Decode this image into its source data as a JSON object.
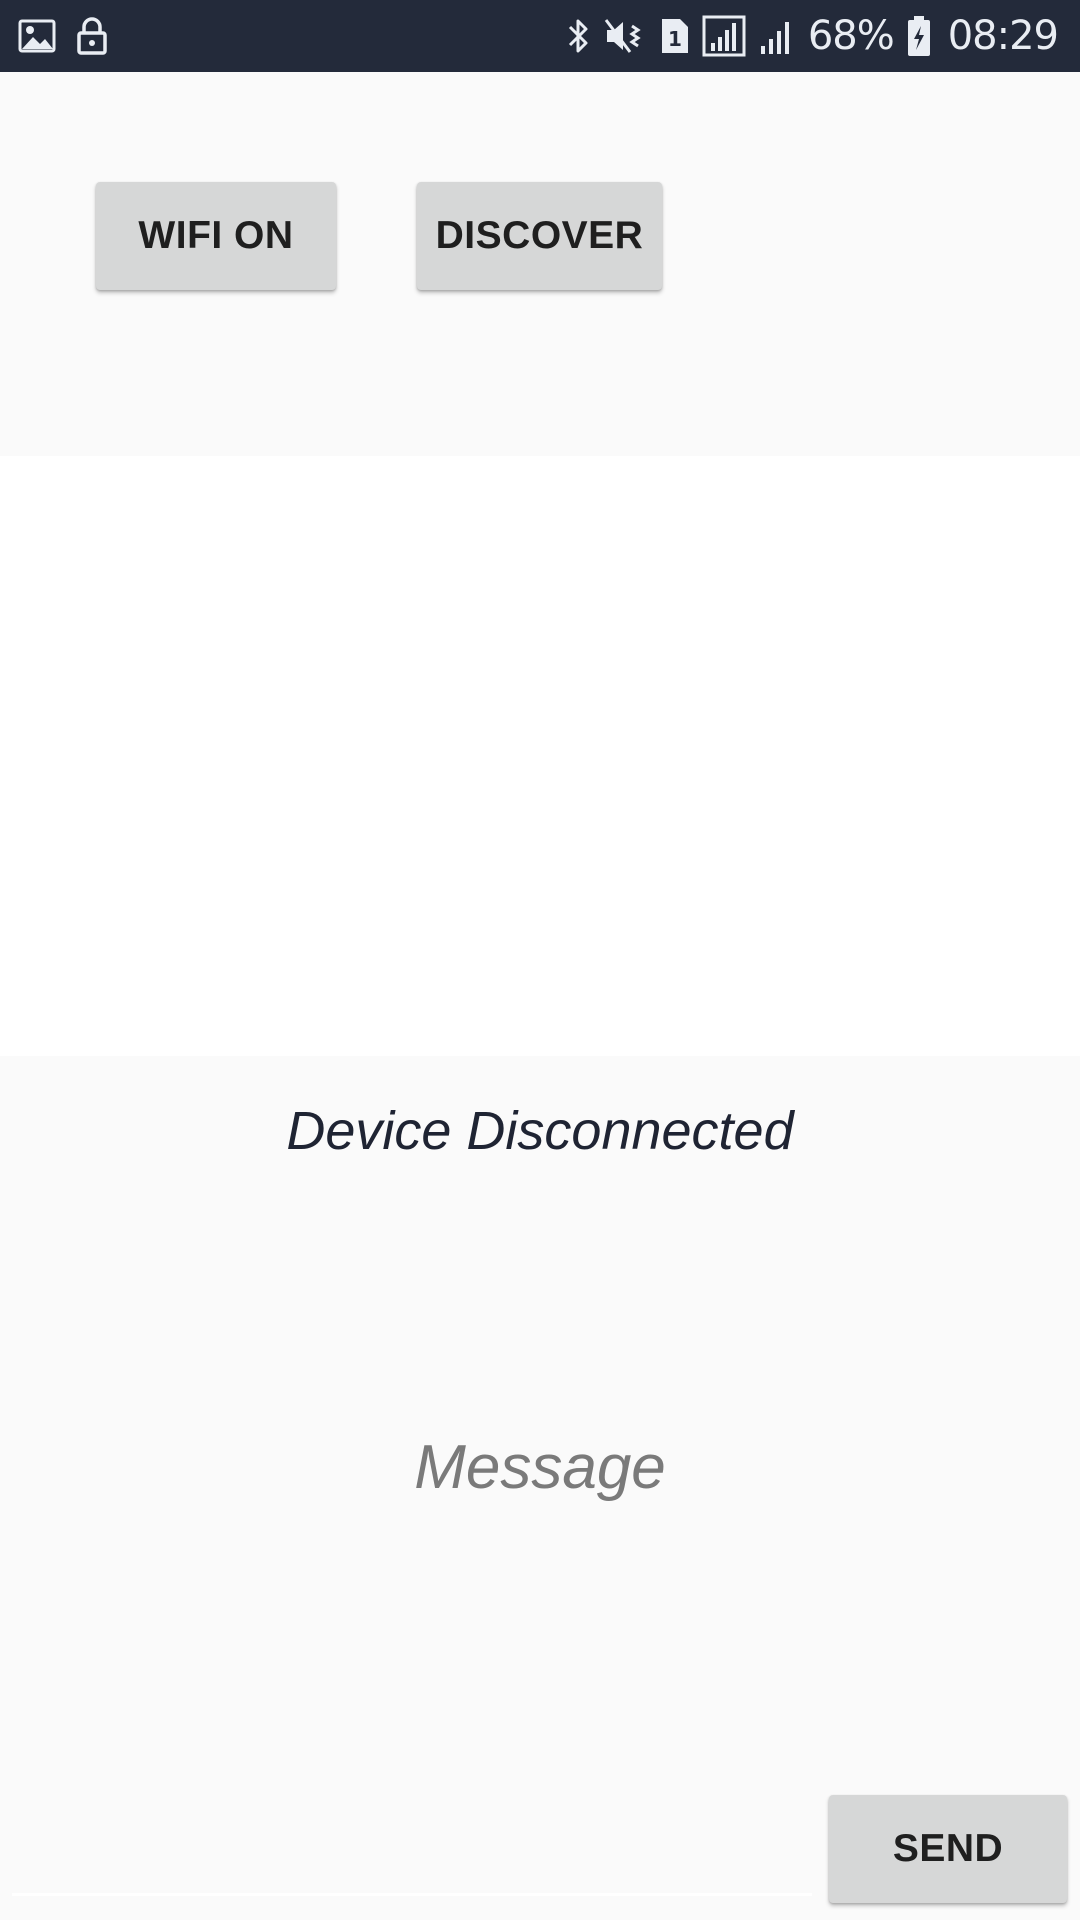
{
  "status_bar": {
    "battery": "68%",
    "time": "08:29",
    "icons_left": [
      "image-icon",
      "lock-icon"
    ],
    "icons_right": [
      "bluetooth-icon",
      "mute-vibrate-icon",
      "sim-1-icon",
      "signal-icon",
      "signal-icon",
      "battery-charging-icon"
    ],
    "background": "#232a3a"
  },
  "toolbar": {
    "wifi_label": "WIFI ON",
    "discover_label": "DISCOVER"
  },
  "connection": {
    "status": "Device Disconnected"
  },
  "message": {
    "display_placeholder": "Message",
    "input_value": "",
    "send_label": "SEND"
  },
  "colors": {
    "button_bg": "#d6d7d7",
    "page_bg": "#fafafa",
    "list_bg": "#ffffff",
    "status_text": "#1f2433",
    "placeholder_text": "#7a7a7a"
  }
}
